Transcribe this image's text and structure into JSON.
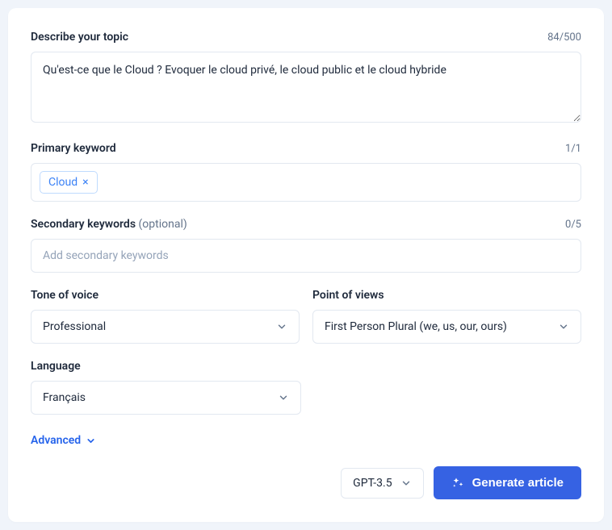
{
  "topic": {
    "label": "Describe your topic",
    "counter": "84/500",
    "value": "Qu'est-ce que le Cloud ? Evoquer le cloud privé, le cloud public et le cloud hybride"
  },
  "primary_keyword": {
    "label": "Primary keyword",
    "counter": "1/1",
    "tags": [
      "Cloud"
    ]
  },
  "secondary_keywords": {
    "label": "Secondary keywords",
    "optional": "(optional)",
    "counter": "0/5",
    "placeholder": "Add secondary keywords"
  },
  "tone": {
    "label": "Tone of voice",
    "value": "Professional"
  },
  "pov": {
    "label": "Point of views",
    "value": "First Person Plural (we, us, our, ours)"
  },
  "language": {
    "label": "Language",
    "value": "Français"
  },
  "advanced": {
    "label": "Advanced"
  },
  "footer": {
    "model": "GPT-3.5",
    "generate": "Generate article"
  }
}
